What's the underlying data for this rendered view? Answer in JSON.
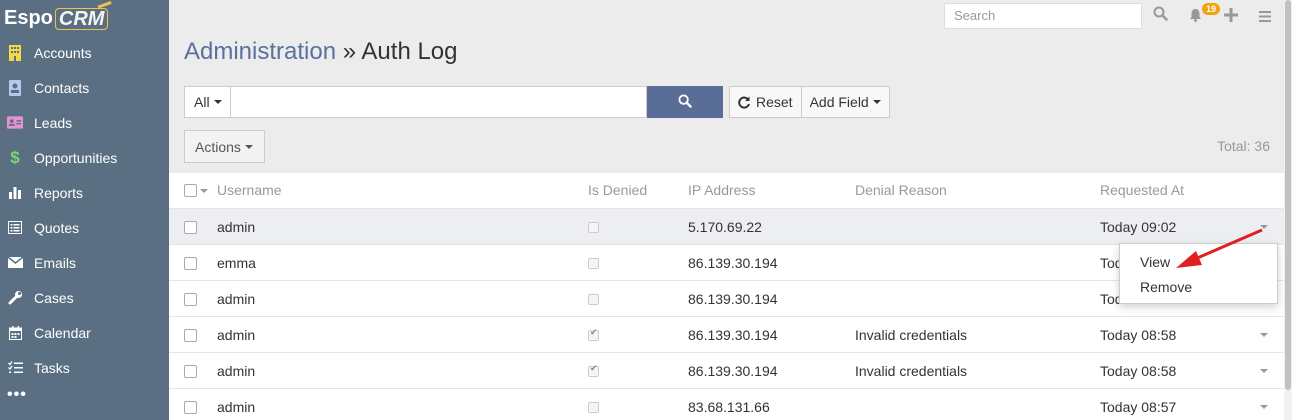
{
  "app": {
    "logo_text_1": "Espo",
    "logo_text_2": "CRM"
  },
  "sidebar": {
    "items": [
      {
        "label": "Accounts",
        "icon": "building-icon"
      },
      {
        "label": "Contacts",
        "icon": "contact-card-icon"
      },
      {
        "label": "Leads",
        "icon": "id-card-icon"
      },
      {
        "label": "Opportunities",
        "icon": "dollar-icon"
      },
      {
        "label": "Reports",
        "icon": "bar-chart-icon"
      },
      {
        "label": "Quotes",
        "icon": "list-icon"
      },
      {
        "label": "Emails",
        "icon": "envelope-icon"
      },
      {
        "label": "Cases",
        "icon": "wrench-icon"
      },
      {
        "label": "Calendar",
        "icon": "calendar-icon"
      },
      {
        "label": "Tasks",
        "icon": "tasks-icon"
      }
    ],
    "more": "•••"
  },
  "topbar": {
    "search_placeholder": "Search",
    "notification_count": "19"
  },
  "header": {
    "parent": "Administration",
    "separator": " » ",
    "title": "Auth Log"
  },
  "filter": {
    "scope_label": "All",
    "text_value": "",
    "reset_label": "Reset",
    "add_field_label": "Add Field"
  },
  "actions_label": "Actions",
  "total_text": "Total: 36",
  "table": {
    "columns": [
      "Username",
      "Is Denied",
      "IP Address",
      "Denial Reason",
      "Requested At"
    ],
    "rows": [
      {
        "username": "admin",
        "is_denied": false,
        "ip": "5.170.69.22",
        "reason": "",
        "requested": "Today 09:02"
      },
      {
        "username": "emma",
        "is_denied": false,
        "ip": "86.139.30.194",
        "reason": "",
        "requested": "Tod"
      },
      {
        "username": "admin",
        "is_denied": false,
        "ip": "86.139.30.194",
        "reason": "",
        "requested": "Tod"
      },
      {
        "username": "admin",
        "is_denied": true,
        "ip": "86.139.30.194",
        "reason": "Invalid credentials",
        "requested": "Today 08:58"
      },
      {
        "username": "admin",
        "is_denied": true,
        "ip": "86.139.30.194",
        "reason": "Invalid credentials",
        "requested": "Today 08:58"
      },
      {
        "username": "admin",
        "is_denied": false,
        "ip": "83.68.131.66",
        "reason": "",
        "requested": "Today 08:57"
      }
    ]
  },
  "row_menu": {
    "items": [
      "View",
      "Remove"
    ]
  },
  "colors": {
    "sidebar_bg": "#5a7082",
    "accent_button": "#5a6d96",
    "link": "#5a70a0",
    "annotation_arrow": "#e02020",
    "badge": "#f0a30a"
  }
}
